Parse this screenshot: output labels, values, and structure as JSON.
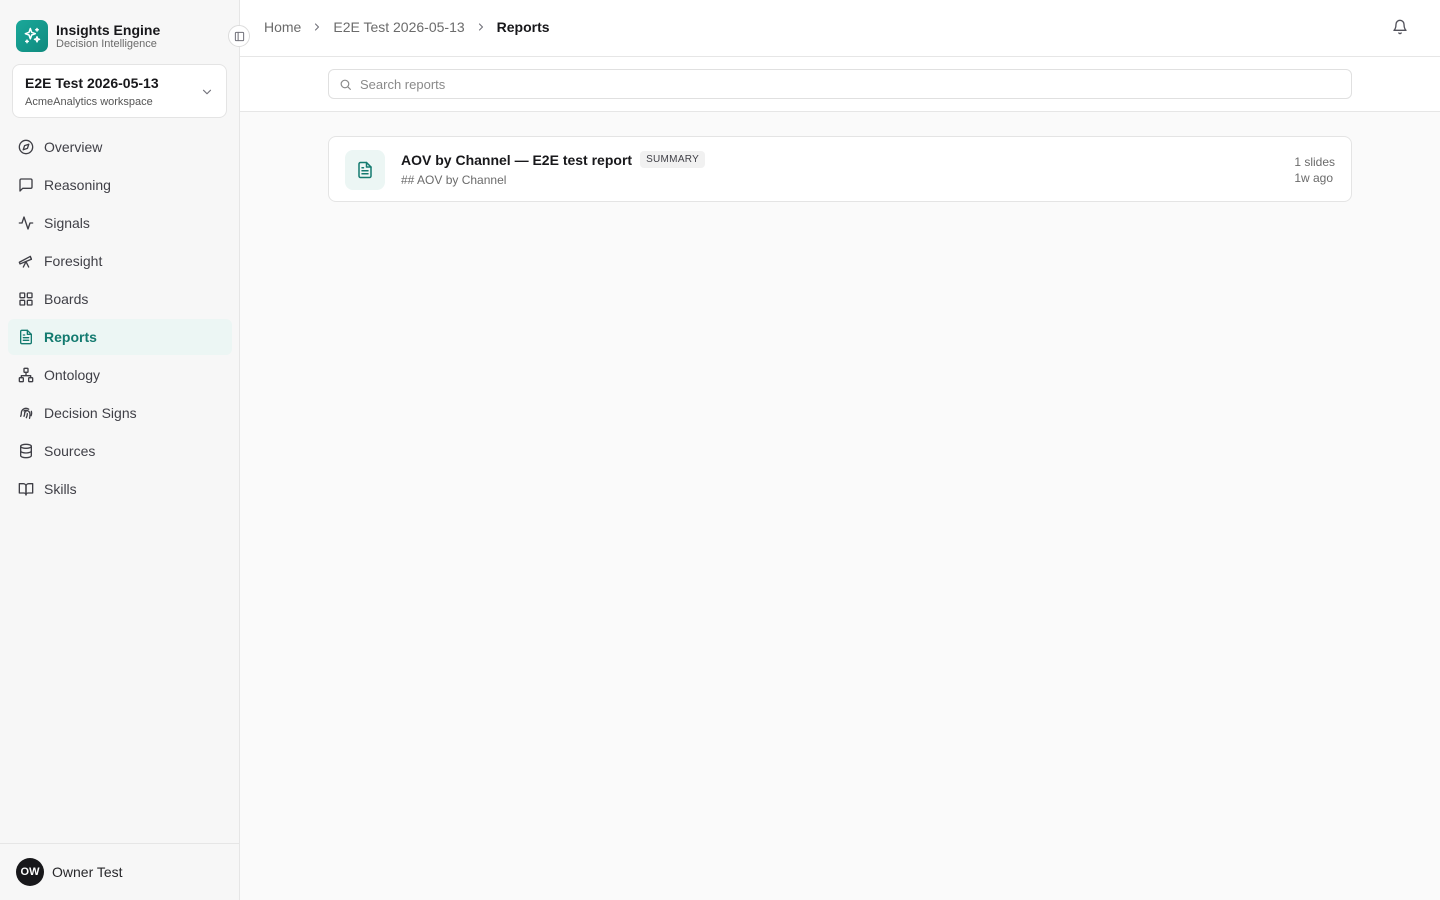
{
  "brand": {
    "name": "Insights Engine",
    "subtitle": "Decision Intelligence"
  },
  "workspace": {
    "name": "E2E Test 2026-05-13",
    "org": "AcmeAnalytics workspace"
  },
  "nav": [
    {
      "label": "Overview",
      "icon": "compass-icon"
    },
    {
      "label": "Reasoning",
      "icon": "message-square-icon"
    },
    {
      "label": "Signals",
      "icon": "activity-icon"
    },
    {
      "label": "Foresight",
      "icon": "telescope-icon"
    },
    {
      "label": "Boards",
      "icon": "grid-icon"
    },
    {
      "label": "Reports",
      "icon": "file-text-icon",
      "active": true
    },
    {
      "label": "Ontology",
      "icon": "network-icon"
    },
    {
      "label": "Decision Signs",
      "icon": "fingerprint-icon"
    },
    {
      "label": "Sources",
      "icon": "database-icon"
    },
    {
      "label": "Skills",
      "icon": "book-open-icon"
    }
  ],
  "user": {
    "initials": "OW",
    "name": "Owner Test"
  },
  "breadcrumb": [
    "Home",
    "E2E Test 2026-05-13",
    "Reports"
  ],
  "search": {
    "placeholder": "Search reports",
    "value": ""
  },
  "reports": [
    {
      "title": "AOV by Channel — E2E test report",
      "badge": "SUMMARY",
      "subtitle": "## AOV by Channel",
      "slides": "1 slides",
      "updated": "1w ago"
    }
  ],
  "colors": {
    "accent": "#137a6f",
    "accent_bg": "#ecf6f4",
    "logo": "#1aa89a"
  }
}
